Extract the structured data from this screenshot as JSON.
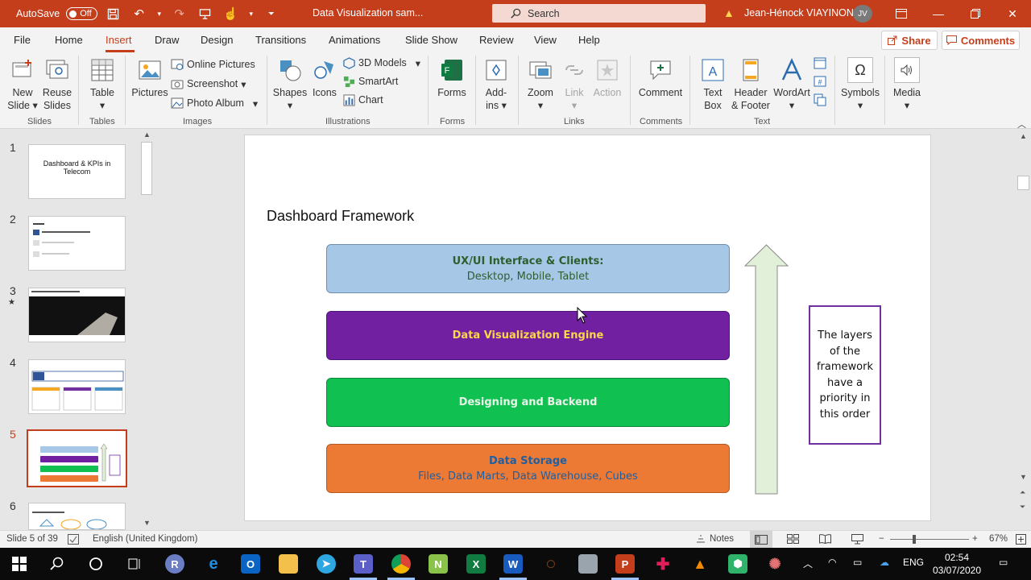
{
  "titlebar": {
    "autosave_label": "AutoSave",
    "autosave_state": "Off",
    "doc_title": "Data Visualization sam...",
    "search_placeholder": "Search",
    "user_name": "Jean-Hénock VIAYINON",
    "user_initials": "JV"
  },
  "tabs": [
    "File",
    "Home",
    "Insert",
    "Draw",
    "Design",
    "Transitions",
    "Animations",
    "Slide Show",
    "Review",
    "View",
    "Help"
  ],
  "active_tab": "Insert",
  "share_label": "Share",
  "comments_label": "Comments",
  "ribbon": {
    "new_slide": "New Slide",
    "reuse_slides": "Reuse Slides",
    "table": "Table",
    "pictures": "Pictures",
    "online_pictures": "Online Pictures",
    "screenshot": "Screenshot",
    "photo_album": "Photo Album",
    "shapes": "Shapes",
    "icons": "Icons",
    "models_3d": "3D Models",
    "smartart": "SmartArt",
    "chart": "Chart",
    "forms": "Forms",
    "addins": "Add-ins",
    "zoom": "Zoom",
    "link": "Link",
    "action": "Action",
    "comment": "Comment",
    "text_box": "Text Box",
    "header_footer": "Header & Footer",
    "wordart": "WordArt",
    "symbols": "Symbols",
    "media": "Media",
    "groups": {
      "slides": "Slides",
      "tables": "Tables",
      "images": "Images",
      "illustrations": "Illustrations",
      "forms": "Forms",
      "links": "Links",
      "comments": "Comments",
      "text": "Text"
    }
  },
  "thumbnails": {
    "numbers": [
      "1",
      "2",
      "3",
      "4",
      "5",
      "6"
    ],
    "slide1_title": "Dashboard & KPIs in Telecom"
  },
  "slide": {
    "title": "Dashboard Framework",
    "layers": [
      {
        "line1": "UX/UI Interface & Clients:",
        "line2": "Desktop, Mobile, Tablet",
        "bg": "#a6c8e6",
        "fg": "#2e5e2e"
      },
      {
        "line1": "Data Visualization Engine",
        "line2": "",
        "bg": "#7020a0",
        "fg": "#ffd54a"
      },
      {
        "line1": "Designing and Backend",
        "line2": "",
        "bg": "#10c050",
        "fg": "#eaf5ea"
      },
      {
        "line1": "Data Storage",
        "line2": "Files, Data Marts, Data Warehouse, Cubes",
        "bg": "#ec7a35",
        "fg": "#1f5fa0"
      }
    ],
    "note": "The layers of the framework have a priority in this order"
  },
  "status": {
    "slide_of": "Slide 5 of 39",
    "language": "English (United Kingdom)",
    "notes": "Notes",
    "zoom": "67%"
  },
  "taskbar": {
    "time": "02:54",
    "date": "03/07/2020",
    "lang": "ENG"
  },
  "colors": {
    "accent": "#c43e1c"
  }
}
